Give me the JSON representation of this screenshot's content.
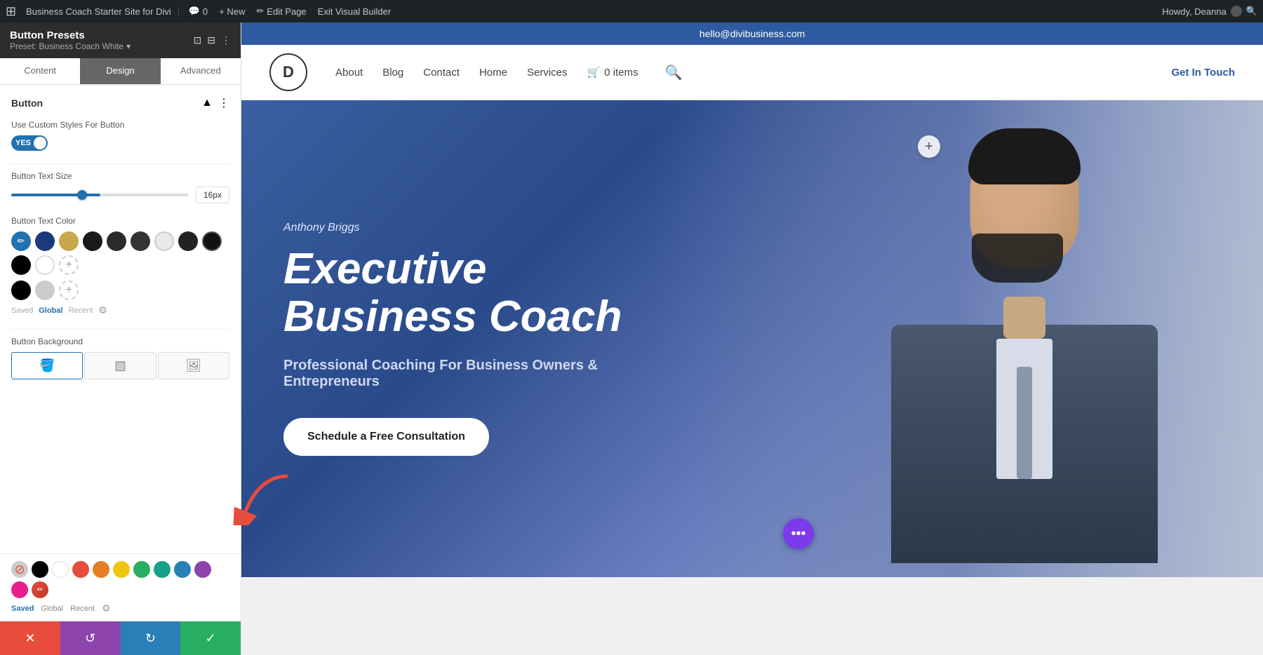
{
  "admin_bar": {
    "wp_logo": "⊞",
    "site_name": "Business Coach Starter Site for Divi",
    "comments": "0",
    "new_label": "+ New",
    "edit_page": "✏ Edit Page",
    "exit_builder": "Exit Visual Builder",
    "howdy": "Howdy, Deanna"
  },
  "panel": {
    "title": "Button Presets",
    "preset_label": "Preset: Business Coach White",
    "tabs": [
      "Content",
      "Design",
      "Advanced"
    ],
    "active_tab": 1,
    "section_title": "Button",
    "toggle_label": "YES",
    "field_custom_styles": "Use Custom Styles For Button",
    "field_text_size": "Button Text Size",
    "slider_value": "16px",
    "field_text_color": "Button Text Color",
    "field_background": "Button Background",
    "saved_label": "Saved",
    "global_label": "Global",
    "recent_label": "Recent"
  },
  "site": {
    "email": "hello@divibusiness.com",
    "logo_letter": "D",
    "nav_links": [
      "About",
      "Blog",
      "Contact",
      "Home",
      "Services"
    ],
    "cart_label": "0 items",
    "cta_label": "Get In Touch",
    "hero_subtitle": "Anthony Briggs",
    "hero_title": "Executive Business Coach",
    "hero_desc": "Professional Coaching For Business Owners & Entrepreneurs",
    "hero_btn": "Schedule a Free Consultation",
    "plus_icon": "+",
    "more_icon": "•••"
  },
  "colors": {
    "swatches": [
      {
        "name": "blue-pen",
        "color": "#2271b1",
        "is_selected": true
      },
      {
        "name": "dark-blue",
        "color": "#1a3a7c"
      },
      {
        "name": "gold",
        "color": "#c9a84c"
      },
      {
        "name": "dark1",
        "color": "#1a1a1a"
      },
      {
        "name": "dark2",
        "color": "#2a2a2a"
      },
      {
        "name": "dark3",
        "color": "#333333"
      },
      {
        "name": "light-transparent",
        "color": "rgba(200,200,200,0.5)"
      },
      {
        "name": "dark-circle",
        "color": "#222222"
      },
      {
        "name": "dark-outline",
        "color": "#111111"
      },
      {
        "name": "black",
        "color": "#000000"
      },
      {
        "name": "white",
        "color": "#ffffff"
      },
      {
        "name": "add",
        "color": "add"
      }
    ],
    "bottom_swatches": [
      {
        "name": "no-color",
        "color": "transparent",
        "has_slash": true
      },
      {
        "name": "black-b",
        "color": "#000000"
      },
      {
        "name": "white-b",
        "color": "#ffffff"
      },
      {
        "name": "red-b",
        "color": "#e74c3c"
      },
      {
        "name": "orange-b",
        "color": "#e67e22"
      },
      {
        "name": "yellow-b",
        "color": "#f1c40f"
      },
      {
        "name": "green-b",
        "color": "#27ae60"
      },
      {
        "name": "teal-b",
        "color": "#16a085"
      },
      {
        "name": "blue-b",
        "color": "#2980b9"
      },
      {
        "name": "purple-b",
        "color": "#8e44ad"
      },
      {
        "name": "pink-b",
        "color": "#e91e8c"
      },
      {
        "name": "red-pencil",
        "color": "#e74c3c"
      }
    ]
  },
  "bottom_bar": {
    "cancel_icon": "✕",
    "undo_icon": "↺",
    "redo_icon": "↻",
    "save_icon": "✓"
  }
}
